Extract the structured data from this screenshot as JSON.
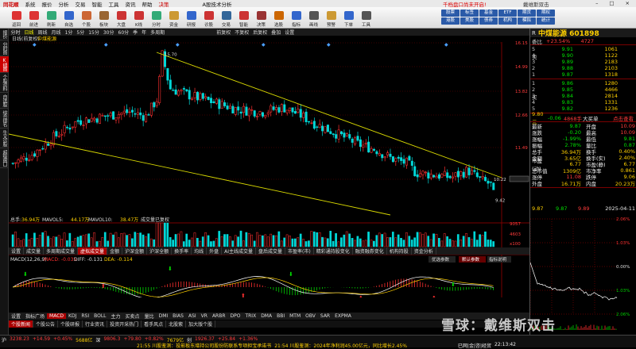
{
  "menu": {
    "app": "同花顺",
    "items": [
      "系统",
      "报价",
      "分析",
      "交易",
      "智能",
      "工具",
      "资讯",
      "帮助",
      "决策"
    ],
    "center": "A股技术分析",
    "promo": "千档盘口尚未开启!",
    "promo2": "戴维斯双击"
  },
  "toolbar": {
    "buttons": [
      "返回",
      "前进",
      "刷新",
      "自选",
      "个股",
      "板块",
      "大盘",
      "K线",
      "分时",
      "资金",
      "研报",
      "诊股",
      "交易",
      "智能",
      "决策",
      "选股",
      "指标",
      "画线",
      "预警",
      "下单",
      "工具"
    ],
    "right": [
      "股票",
      "标签",
      "基金",
      "ETF",
      "期货",
      "期权",
      "港股",
      "美股",
      "债券",
      "机构",
      "模拟",
      "统计"
    ]
  },
  "leftnav": [
    "报价",
    "分时图",
    "K线图",
    "个股资料",
    "自选股",
    "综合排名",
    "牛叉诊股",
    "超级盘口"
  ],
  "period": {
    "items": [
      "分时",
      "日线",
      "周线",
      "月线",
      "1分",
      "5分",
      "15分",
      "30分",
      "60分",
      "季",
      "年",
      "多周期"
    ],
    "extras": [
      "前复权",
      "不复权",
      "后复权",
      "叠加",
      "设置"
    ],
    "active": "日线"
  },
  "chart": {
    "name": "中煤能源",
    "mode": "日线(前复权)",
    "yticks": [
      "16.15",
      "14.99",
      "13.82",
      "12.66",
      "11.49",
      "10.32"
    ],
    "high_label": "15.70",
    "low_label": "9.42",
    "last_label": "10.22",
    "dates": [
      "07",
      "08",
      "09",
      "10",
      "11",
      "12",
      "01",
      "02",
      "03",
      "04"
    ]
  },
  "volume": {
    "legend_prefix": "总手",
    "value": "36.94万",
    "ma5_label": "MAVOL5",
    "ma5": "44.17万",
    "ma10_label": "MAVOL10",
    "ma10": "38.47万",
    "note": "成交量已复权",
    "yticks": [
      "9057",
      "4603",
      "x100"
    ]
  },
  "tabs1": [
    "设置",
    "成交量",
    "多周期成交量",
    "虚拟成交量",
    "金额",
    "沪深金额",
    "沪深全额",
    "换手率",
    "均线",
    "外盘",
    "AI主线成交量",
    "盘后成交量",
    "市盈率(市)",
    "精彩通持股变化",
    "融资融券变化",
    "机构持股",
    "资金分析"
  ],
  "macd": {
    "title": "MACD(12,26,9)",
    "macd": "MACD: -0.035",
    "diff": "DIFF: -0.131",
    "dea": "DEA: -0.114",
    "btn1": "优选参数",
    "btn2": "默认参数",
    "btn3": "指标说明"
  },
  "tabs2": [
    "设置",
    "指标广场",
    "MACD",
    "KDJ",
    "RSI",
    "BOLL",
    "主力",
    "买卖点",
    "量比",
    "DMI",
    "BIAS",
    "ASI",
    "VR",
    "ARBR",
    "DPO",
    "TRIX",
    "DMA",
    "BBI",
    "MTM",
    "OBV",
    "SAR",
    "EXPMA"
  ],
  "tabs3": [
    "个股新闻",
    "个股公告",
    "个股研报",
    "行业资讯",
    "投资开采热门",
    "看手风点",
    "北股紫",
    "加大版个股"
  ],
  "status": {
    "a1": "沪",
    "a2": "3238.23",
    "a3": "+14.59",
    "a4": "+0.45%",
    "a5": "5688亿",
    "a6": "深",
    "a7": "9806.3",
    "a8": "+79.80",
    "a9": "+0.82%",
    "a10": "7679亿",
    "a11": "创",
    "a12": "1926.37",
    "a13": "+25.84",
    "a14": "+1.36%",
    "b1": "21:55 川股鉴测：投影板东增持公司股份防联系专项担宝承诺书",
    "b2": "21:54 川股鉴测：2024年净利润45.00亿元，同比增长2.45%",
    "b3": "已网|金|咨|经贸",
    "time": "22:13:42"
  },
  "right": {
    "label": "R",
    "name": "中煤能源 601898",
    "webi": "委比",
    "webi_val": "+23.54%",
    "weicha": "4727",
    "sells": [
      [
        "5",
        "9.91",
        "1061"
      ],
      [
        "4",
        "9.90",
        "1122"
      ],
      [
        "3",
        "9.89",
        "2183"
      ],
      [
        "2",
        "9.88",
        "2103"
      ],
      [
        "1",
        "9.87",
        "1318"
      ]
    ],
    "buys": [
      [
        "1",
        "9.86",
        "1280"
      ],
      [
        "2",
        "9.85",
        "4466"
      ],
      [
        "3",
        "9.84",
        "2814"
      ],
      [
        "4",
        "9.83",
        "1331"
      ],
      [
        "5",
        "9.82",
        "1236"
      ]
    ],
    "sell_tag": "卖",
    "buy_tag": "买",
    "px_row": {
      "price": "9.80元",
      "chg": "-0.06",
      "vol": "4868手",
      "tag": "大买单",
      "link": "点击查看"
    },
    "quote": [
      [
        "最新",
        "9.87",
        "开盘",
        "10.09"
      ],
      [
        "涨跌",
        "-0.20",
        "最高",
        "10.09"
      ],
      [
        "涨幅",
        "-1.99%",
        "最低",
        "9.81"
      ],
      [
        "振幅",
        "2.78%",
        "量比",
        "0.87"
      ],
      [
        "总手",
        "36.94万",
        "换手",
        "0.40%"
      ],
      [
        "金额",
        "3.65亿",
        "换手(实)",
        "2.40%"
      ],
      [
        "市盈(动)",
        "6.77",
        "市盈(静)",
        "6.77"
      ],
      [
        "总市值",
        "1309亿",
        "市净率",
        "0.861"
      ],
      [
        "涨停",
        "11.08",
        "跌停",
        "9.06"
      ],
      [
        "外盘",
        "16.71万",
        "内盘",
        "20.23万"
      ]
    ],
    "mini_left": "9.87",
    "mini_v": "9.87",
    "mini_v2": "9.89",
    "mini_date": "2025-04-11",
    "mini_pcts": [
      "2.06%",
      "1.03%",
      "0.00%",
      "1.03%",
      "2.06%"
    ]
  },
  "watermark": "雪球：戴维斯双击"
}
